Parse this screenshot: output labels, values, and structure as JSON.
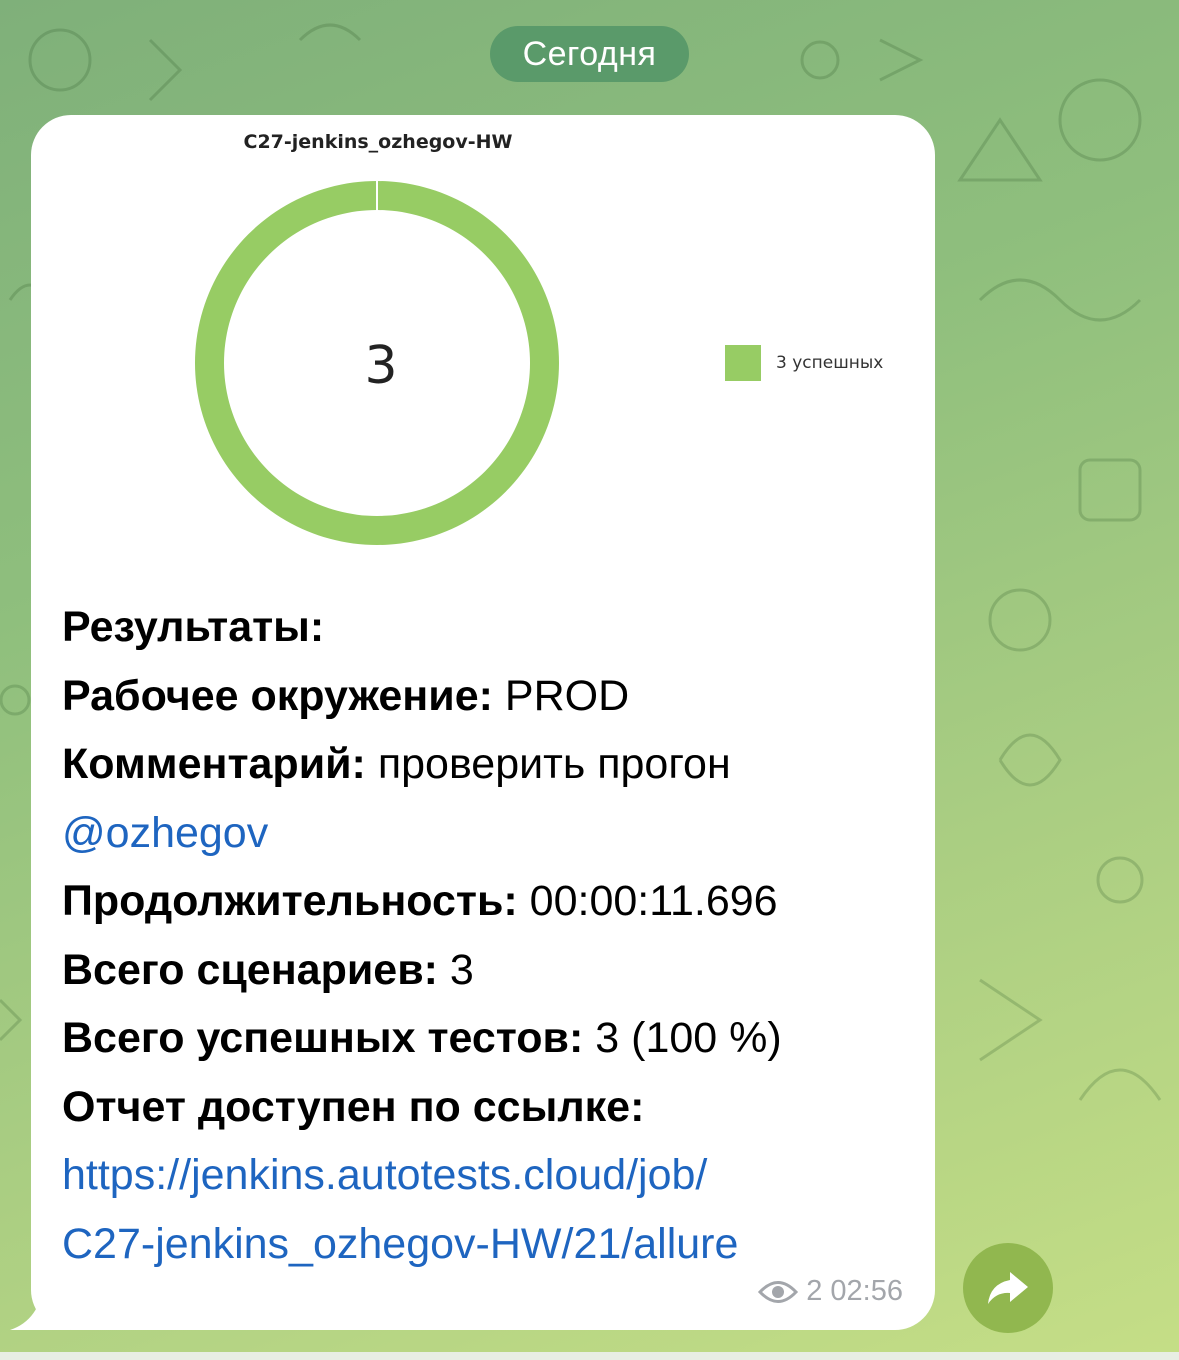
{
  "date_separator": "Сегодня",
  "message": {
    "chart_data": {
      "type": "pie",
      "title": "C27-jenkins_ozhegov-HW",
      "center_label": "3",
      "slices": [
        {
          "label": "3 успешных",
          "value": 3,
          "color": "#97cc64"
        }
      ],
      "legend_position": "right"
    },
    "lines": [
      {
        "label": "Результаты:",
        "value": ""
      },
      {
        "label": "Рабочее окружение:",
        "value": " PROD"
      },
      {
        "label": "Комментарий:",
        "value": " проверить прогон"
      },
      {
        "mention": "@ozhegov"
      },
      {
        "label": "Продолжительность:",
        "value": " 00:00:11.696"
      },
      {
        "label": "Всего сценариев:",
        "value": " 3"
      },
      {
        "label": "Всего успешных тестов:",
        "value": " 3 (100 %)"
      },
      {
        "label": "Отчет доступен по ссылке:",
        "value": ""
      }
    ],
    "link_line1": "https://jenkins.autotests.cloud/job/",
    "link_line2": "C27-jenkins_ozhegov-HW/21/allure",
    "views": "2",
    "time": "02:56"
  },
  "icons": {
    "views": "eye-icon",
    "share": "share-arrow-icon"
  },
  "colors": {
    "link": "#1e65c0",
    "share_button": "#91b74f",
    "date_pill": "#5a9a6a"
  }
}
